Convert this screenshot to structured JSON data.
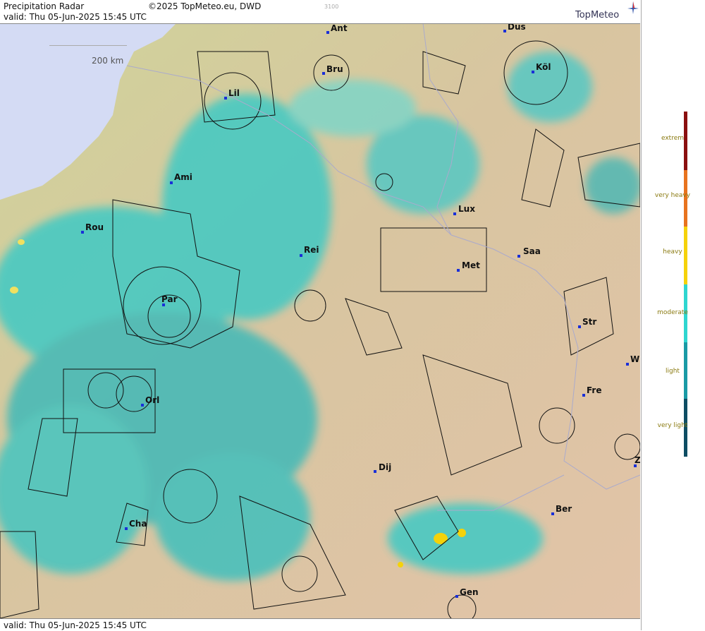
{
  "header": {
    "title": "Precipitation Radar",
    "copyright": "©2025 TopMeteo.eu, DWD",
    "valid": "valid:  Thu  05-Jun-2025 15:45 UTC",
    "faint_label": "3100",
    "logo": "TopMeteo"
  },
  "footer": {
    "valid": "valid:  Thu  05-Jun-2025 15:45 UTC"
  },
  "scale": {
    "label": "200 km"
  },
  "cities": [
    {
      "name": "Ant"
    },
    {
      "name": "Düs"
    },
    {
      "name": "Köl"
    },
    {
      "name": "Bru"
    },
    {
      "name": "Lil"
    },
    {
      "name": "Ami"
    },
    {
      "name": "Rou"
    },
    {
      "name": "Rei"
    },
    {
      "name": "Lux"
    },
    {
      "name": "Saa"
    },
    {
      "name": "Met"
    },
    {
      "name": "Par"
    },
    {
      "name": "Str"
    },
    {
      "name": "W"
    },
    {
      "name": "Fre"
    },
    {
      "name": "Orl"
    },
    {
      "name": "Dij"
    },
    {
      "name": "Ber"
    },
    {
      "name": "Cha"
    },
    {
      "name": "Gen"
    },
    {
      "name": "Z"
    }
  ],
  "legend": [
    {
      "label": "extrem",
      "color": "#8b0f0f"
    },
    {
      "label": "very heavy",
      "color": "#e8731e"
    },
    {
      "label": "heavy",
      "color": "#f5d20a"
    },
    {
      "label": "moderate",
      "color": "#2fd6d0"
    },
    {
      "label": "light",
      "color": "#1a9aa5"
    },
    {
      "label": "very light",
      "color": "#0d4d63"
    }
  ],
  "colors": {
    "land": "#d9c999",
    "sea": "#cfd8f2",
    "radar": "#3fc9c4",
    "boundary": "#111111"
  }
}
